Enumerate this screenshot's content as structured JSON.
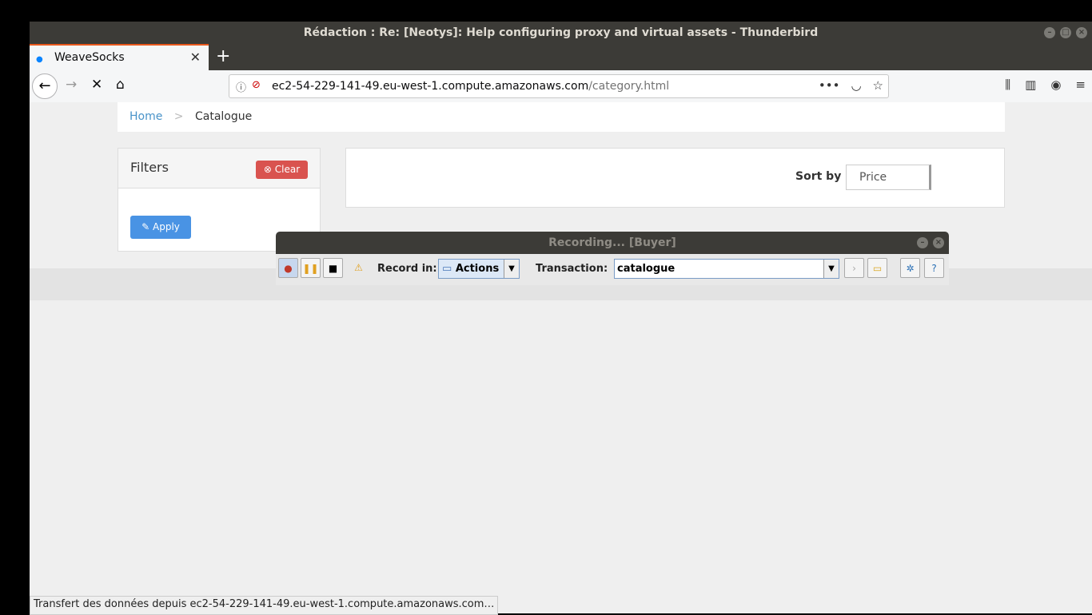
{
  "window": {
    "title": "Rédaction : Re: [Neotys]: Help configuring proxy and virtual assets - Thunderbird"
  },
  "browser": {
    "tab_title": "WeaveSocks",
    "url_host": "ec2-54-229-141-49.eu-west-1.compute.amazonaws.com",
    "url_path": "/category.html",
    "status_text": "Transfert des données depuis ec2-54-229-141-49.eu-west-1.compute.amazonaws.com…"
  },
  "page": {
    "breadcrumb": {
      "home": "Home",
      "separator": ">",
      "current": "Catalogue"
    },
    "filters": {
      "title": "Filters",
      "clear_label": "Clear",
      "apply_label": "Apply"
    },
    "sort": {
      "label": "Sort by",
      "selected": "Price"
    }
  },
  "recorder": {
    "title": "Recording... [Buyer]",
    "record_in_label": "Record in:",
    "record_in_value": "Actions",
    "transaction_label": "Transaction:",
    "transaction_value": "catalogue"
  },
  "colors": {
    "clear": "#d9534f",
    "apply": "#4993e4",
    "link": "#4993c9",
    "tab_accent": "#e8581c"
  },
  "icons": [
    "back-arrow-icon",
    "forward-arrow-icon",
    "stop-icon",
    "home-icon",
    "info-icon",
    "insecure-lock-icon",
    "more-icon",
    "pocket-icon",
    "bookmark-star-icon",
    "library-icon",
    "sidebar-icon",
    "account-icon",
    "menu-icon",
    "record-icon",
    "pause-icon",
    "stop-square-icon",
    "warning-icon",
    "folder-icon",
    "next-icon",
    "open-folder-icon",
    "collapse-icon",
    "help-icon"
  ]
}
